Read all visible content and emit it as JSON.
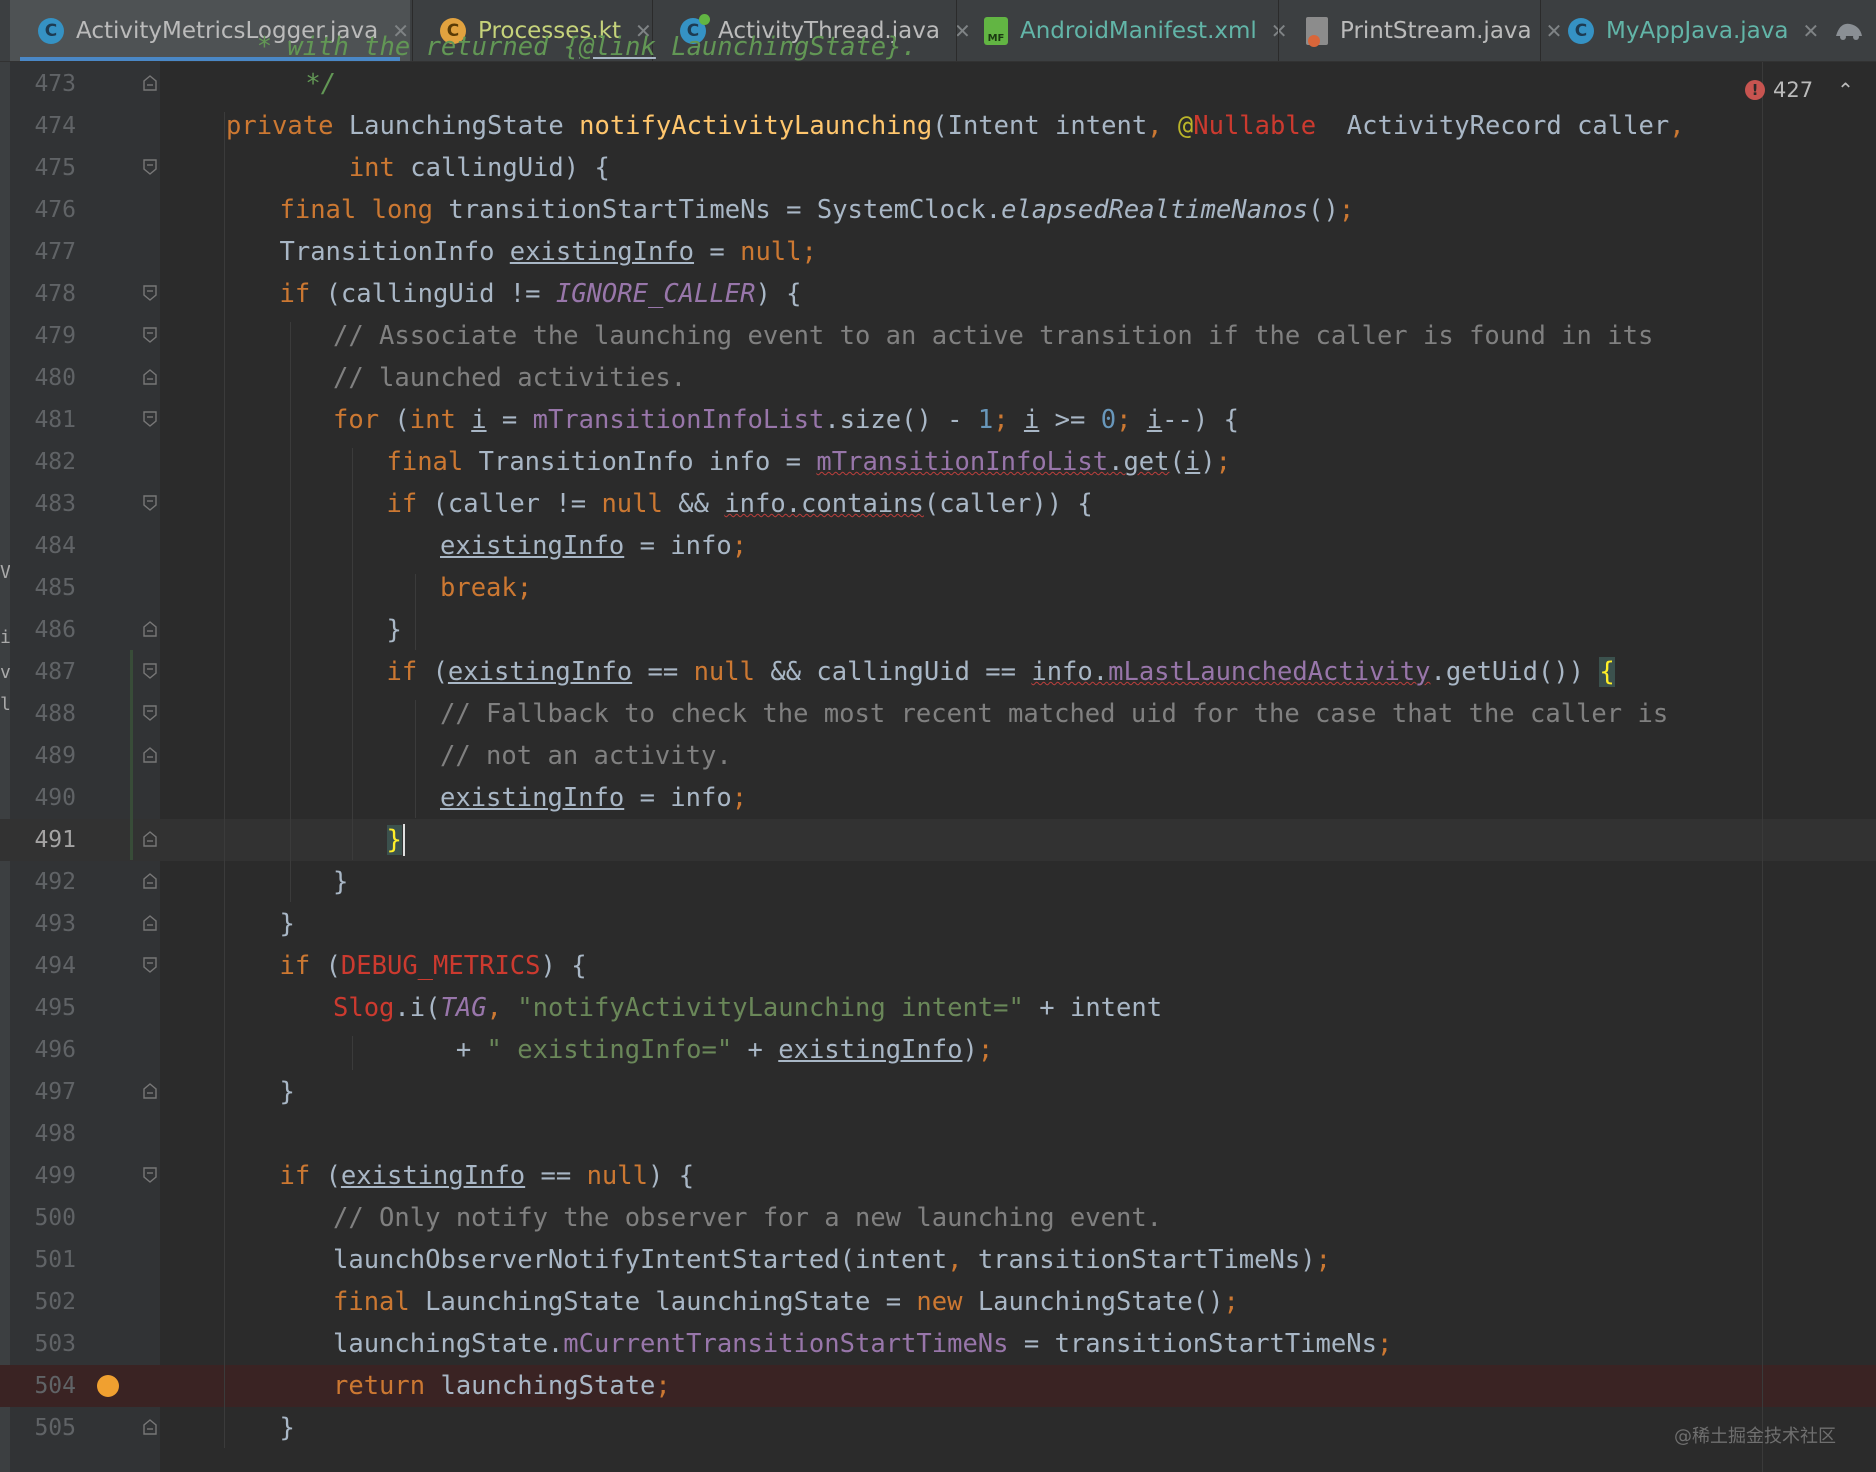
{
  "tabs": [
    {
      "label": "ActivityMetricsLogger.java",
      "icon": "java-class-icon",
      "color": "#bbbbbb",
      "active": true
    },
    {
      "label": "Processes.kt",
      "icon": "kotlin-class-icon",
      "color": "#c5d27a",
      "active": false
    },
    {
      "label": "ActivityThread.java",
      "icon": "java-class-icon",
      "color": "#bbbbbb",
      "active": false
    },
    {
      "label": "AndroidManifest.xml",
      "icon": "manifest-file-icon",
      "color": "#62b5a8",
      "active": false
    },
    {
      "label": "PrintStream.java",
      "icon": "java-lib-file-icon",
      "color": "#bbbbbb",
      "active": false
    },
    {
      "label": "MyAppJava.java",
      "icon": "java-class-icon",
      "color": "#62b5a8",
      "active": false
    }
  ],
  "error_count": "427",
  "watermark": "@稀土掘金技术社区",
  "current_line": 491,
  "breakpoint_line": 504,
  "lines": [
    {
      "num": "473",
      "fold": "end",
      "indent": 0,
      "tokens": [
        [
          "jd",
          "    */"
        ]
      ]
    },
    {
      "num": "474",
      "fold": "",
      "indent": 0,
      "tokens": [
        [
          "kw",
          "private "
        ],
        [
          "",
          "LaunchingState "
        ],
        [
          "fn",
          "notifyActivityLaunching"
        ],
        [
          "",
          "(Intent intent"
        ],
        [
          "kw",
          ", "
        ],
        [
          "ann",
          "@"
        ],
        [
          "red",
          "Nullable"
        ],
        [
          "",
          ""
        ],
        [
          "",
          "  ActivityRecord caller"
        ],
        [
          "kw",
          ","
        ]
      ]
    },
    {
      "num": "475",
      "fold": "start",
      "indent": 0,
      "tokens": [
        [
          "kw",
          "        int "
        ],
        [
          "",
          "callingUid) {"
        ]
      ]
    },
    {
      "num": "476",
      "fold": "",
      "indent": 1,
      "tokens": [
        [
          "kw",
          "final long "
        ],
        [
          "",
          "transitionStartTimeNs = SystemClock."
        ],
        [
          "it",
          "elapsedRealtimeNanos"
        ],
        [
          "",
          "()"
        ],
        [
          "kw",
          ";"
        ]
      ]
    },
    {
      "num": "477",
      "fold": "",
      "indent": 1,
      "tokens": [
        [
          "",
          "TransitionInfo "
        ],
        [
          "ul",
          "existingInfo"
        ],
        [
          "",
          " = "
        ],
        [
          "kw",
          "null;"
        ]
      ]
    },
    {
      "num": "478",
      "fold": "start",
      "indent": 1,
      "tokens": [
        [
          "kw",
          "if "
        ],
        [
          "",
          "(callingUid != "
        ],
        [
          "cst",
          "IGNORE_CALLER"
        ],
        [
          "",
          ") {"
        ]
      ]
    },
    {
      "num": "479",
      "fold": "start",
      "indent": 2,
      "tokens": [
        [
          "cm",
          "// Associate the launching event to an active transition if the caller is found in its"
        ]
      ]
    },
    {
      "num": "480",
      "fold": "end",
      "indent": 2,
      "tokens": [
        [
          "cm",
          "// launched activities."
        ]
      ]
    },
    {
      "num": "481",
      "fold": "start",
      "indent": 2,
      "tokens": [
        [
          "kw",
          "for "
        ],
        [
          "",
          "("
        ],
        [
          "kw",
          "int "
        ],
        [
          "ul",
          "i"
        ],
        [
          "",
          " = "
        ],
        [
          "fld",
          "mTransitionInfoList"
        ],
        [
          "",
          ".size() - "
        ],
        [
          "nm",
          "1"
        ],
        [
          "kw",
          "; "
        ],
        [
          "ul",
          "i"
        ],
        [
          "",
          " >= "
        ],
        [
          "nm",
          "0"
        ],
        [
          "kw",
          "; "
        ],
        [
          "ul",
          "i"
        ],
        [
          "",
          "--) {"
        ]
      ]
    },
    {
      "num": "482",
      "fold": "",
      "indent": 3,
      "tokens": [
        [
          "kw",
          "final "
        ],
        [
          "",
          "TransitionInfo info = "
        ],
        [
          "fld wv",
          "mTransitionInfoList"
        ],
        [
          "wv",
          ".get"
        ],
        [
          "",
          "("
        ],
        [
          "ul",
          "i"
        ],
        [
          "",
          ")"
        ],
        [
          "kw",
          ";"
        ]
      ]
    },
    {
      "num": "483",
      "fold": "start",
      "indent": 3,
      "tokens": [
        [
          "kw",
          "if "
        ],
        [
          "",
          "(caller != "
        ],
        [
          "kw",
          "null "
        ],
        [
          "",
          "&& "
        ],
        [
          "wv",
          "info.contains"
        ],
        [
          "",
          "(caller)) {"
        ]
      ]
    },
    {
      "num": "484",
      "fold": "",
      "indent": 4,
      "tokens": [
        [
          "ul",
          "existingInfo"
        ],
        [
          "",
          " = info"
        ],
        [
          "kw",
          ";"
        ]
      ]
    },
    {
      "num": "485",
      "fold": "",
      "indent": 4,
      "tokens": [
        [
          "kw",
          "break;"
        ]
      ]
    },
    {
      "num": "486",
      "fold": "end",
      "indent": 3,
      "tokens": [
        [
          "",
          "}"
        ]
      ]
    },
    {
      "num": "487",
      "fold": "start",
      "indent": 3,
      "tokens": [
        [
          "kw",
          "if "
        ],
        [
          "",
          "("
        ],
        [
          "ul",
          "existingInfo"
        ],
        [
          "",
          " == "
        ],
        [
          "kw",
          "null "
        ],
        [
          "",
          "&& callingUid == "
        ],
        [
          "wv",
          "info."
        ],
        [
          "fld wv",
          "mLastLaunchedActivity"
        ],
        [
          "",
          ".getUid()) "
        ],
        [
          "br brbg",
          "{"
        ]
      ]
    },
    {
      "num": "488",
      "fold": "start",
      "indent": 4,
      "tokens": [
        [
          "cm",
          "// Fallback to check the most recent matched uid for the case that the caller is"
        ]
      ]
    },
    {
      "num": "489",
      "fold": "end",
      "indent": 4,
      "tokens": [
        [
          "cm",
          "// not an activity."
        ]
      ]
    },
    {
      "num": "490",
      "fold": "",
      "indent": 4,
      "tokens": [
        [
          "ul",
          "existingInfo"
        ],
        [
          "",
          " = info"
        ],
        [
          "kw",
          ";"
        ]
      ]
    },
    {
      "num": "491",
      "fold": "end",
      "indent": 3,
      "tokens": [
        [
          "br brbg",
          "}"
        ]
      ]
    },
    {
      "num": "492",
      "fold": "end",
      "indent": 2,
      "tokens": [
        [
          "",
          "}"
        ]
      ]
    },
    {
      "num": "493",
      "fold": "end",
      "indent": 1,
      "tokens": [
        [
          "",
          "}"
        ]
      ]
    },
    {
      "num": "494",
      "fold": "start",
      "indent": 1,
      "tokens": [
        [
          "kw",
          "if "
        ],
        [
          "",
          "("
        ],
        [
          "red",
          "DEBUG_METRICS"
        ],
        [
          "",
          ") {"
        ]
      ]
    },
    {
      "num": "495",
      "fold": "",
      "indent": 2,
      "tokens": [
        [
          "red",
          "Slog"
        ],
        [
          "",
          ".i("
        ],
        [
          "cst",
          "TAG"
        ],
        [
          "kw",
          ", "
        ],
        [
          "st",
          "\"notifyActivityLaunching intent=\""
        ],
        [
          "",
          " + intent"
        ]
      ]
    },
    {
      "num": "496",
      "fold": "",
      "indent": 2,
      "tokens": [
        [
          "",
          "        + "
        ],
        [
          "st",
          "\" existingInfo=\""
        ],
        [
          "",
          " + "
        ],
        [
          "ul",
          "existingInfo"
        ],
        [
          "",
          ")"
        ],
        [
          "kw",
          ";"
        ]
      ]
    },
    {
      "num": "497",
      "fold": "end",
      "indent": 1,
      "tokens": [
        [
          "",
          "}"
        ]
      ]
    },
    {
      "num": "498",
      "fold": "",
      "indent": 0,
      "tokens": []
    },
    {
      "num": "499",
      "fold": "start",
      "indent": 1,
      "tokens": [
        [
          "kw",
          "if "
        ],
        [
          "",
          "("
        ],
        [
          "ul",
          "existingInfo"
        ],
        [
          "",
          " == "
        ],
        [
          "kw",
          "null"
        ],
        [
          "",
          ") {"
        ]
      ]
    },
    {
      "num": "500",
      "fold": "",
      "indent": 2,
      "tokens": [
        [
          "cm",
          "// Only notify the observer for a new launching event."
        ]
      ]
    },
    {
      "num": "501",
      "fold": "",
      "indent": 2,
      "tokens": [
        [
          "",
          "launchObserverNotifyIntentStarted(intent"
        ],
        [
          "kw",
          ", "
        ],
        [
          "",
          "transitionStartTimeNs)"
        ],
        [
          "kw",
          ";"
        ]
      ]
    },
    {
      "num": "502",
      "fold": "",
      "indent": 2,
      "tokens": [
        [
          "kw",
          "final "
        ],
        [
          "",
          "LaunchingState launchingState = "
        ],
        [
          "kw",
          "new "
        ],
        [
          "",
          "LaunchingState()"
        ],
        [
          "kw",
          ";"
        ]
      ]
    },
    {
      "num": "503",
      "fold": "",
      "indent": 2,
      "tokens": [
        [
          "",
          "launchingState."
        ],
        [
          "fld",
          "mCurrentTransitionStartTimeNs"
        ],
        [
          "",
          " = transitionStartTimeNs"
        ],
        [
          "kw",
          ";"
        ]
      ]
    },
    {
      "num": "504",
      "fold": "",
      "indent": 2,
      "tokens": [
        [
          "kw",
          "return "
        ],
        [
          "",
          "launchingState"
        ],
        [
          "kw",
          ";"
        ]
      ]
    },
    {
      "num": "505",
      "fold": "end",
      "indent": 1,
      "tokens": [
        [
          "",
          "}"
        ]
      ]
    }
  ],
  "top_partial": [
    [
      "jd",
      "  * with the returned {"
    ],
    [
      "jd ul",
      "@link"
    ],
    [
      "jd",
      " LaunchingState}."
    ]
  ]
}
